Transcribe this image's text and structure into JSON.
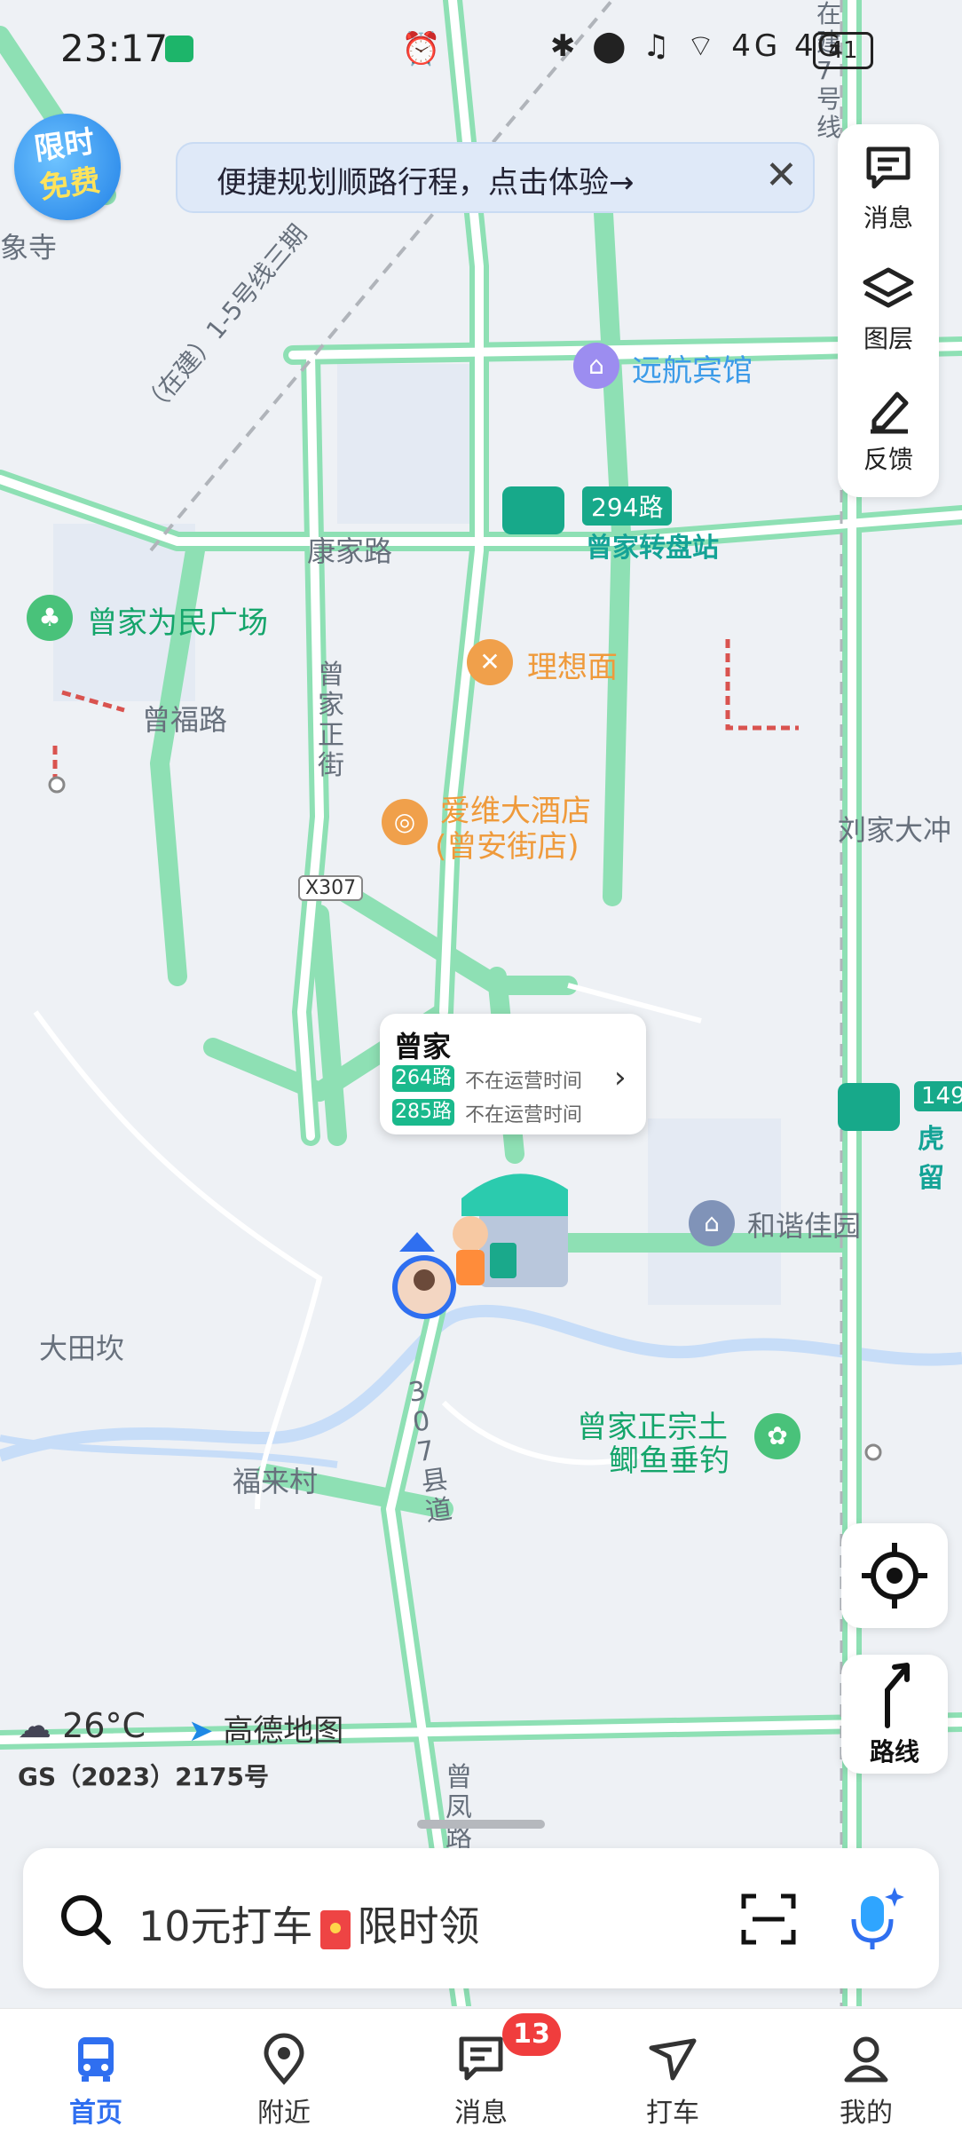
{
  "status_bar": {
    "time": "23:17",
    "icons": "✱ ⬤ ♫ ⌔ 4G 4G",
    "battery": "41"
  },
  "promo": {
    "badge_line1": "限时",
    "badge_line2": "免费"
  },
  "banner": {
    "text": "便捷规划顺路行程，点击体验→"
  },
  "tools": [
    {
      "label": "消息",
      "icon": "message-icon"
    },
    {
      "label": "图层",
      "icon": "layers-icon"
    },
    {
      "label": "反馈",
      "icon": "feedback-pen-icon"
    }
  ],
  "map_labels": {
    "temple": "象寺",
    "metro_line": "（在建）1-5号线三期",
    "hotel": "远航宾馆",
    "bus_294": "294路",
    "zengjia_roundabout": "曾家转盘站",
    "kangjia_road": "康家路",
    "square": "曾家为民广场",
    "noodle": "理想面",
    "zengfu_road": "曾福路",
    "zengjia_main_st": "曾家正街",
    "hotel2_line1": "爱维大酒店",
    "hotel2_line2": "(曾安街店)",
    "x307": "X307",
    "liujia": "刘家大冲",
    "bus_149": "149",
    "hu": "虎留",
    "hexie": "和谐佳园",
    "datian": "大田坎",
    "fishing_line1": "曾家正宗土",
    "fishing_line2": "鲫鱼垂钓",
    "fulai": "福来村",
    "county_road": "307县道",
    "zengfeng": "曾凤路",
    "line7": "在建7号线"
  },
  "bus_popup": {
    "stop": "曾家",
    "routes": [
      {
        "route": "264路",
        "status": "不在运营时间"
      },
      {
        "route": "285路",
        "status": "不在运营时间"
      }
    ]
  },
  "weather": {
    "temp": "26°C"
  },
  "brand": "高德地图",
  "approval": "GS（2023）2175号",
  "route_button": "路线",
  "search": {
    "placeholder_left": "10元打车",
    "placeholder_right": "限时领"
  },
  "tabs": [
    {
      "label": "首页",
      "icon": "bus-icon",
      "active": true
    },
    {
      "label": "附近",
      "icon": "location-pin-icon"
    },
    {
      "label": "消息",
      "icon": "message-icon"
    },
    {
      "label": "打车",
      "icon": "taxi-icon"
    },
    {
      "label": "我的",
      "icon": "person-icon"
    }
  ],
  "message_badge": "13",
  "colors": {
    "road": "#8ee0b4",
    "road_fill": "#ffffff",
    "bg": "#eef1f5",
    "accent": "#2f6ff0",
    "teal": "#14a396"
  }
}
